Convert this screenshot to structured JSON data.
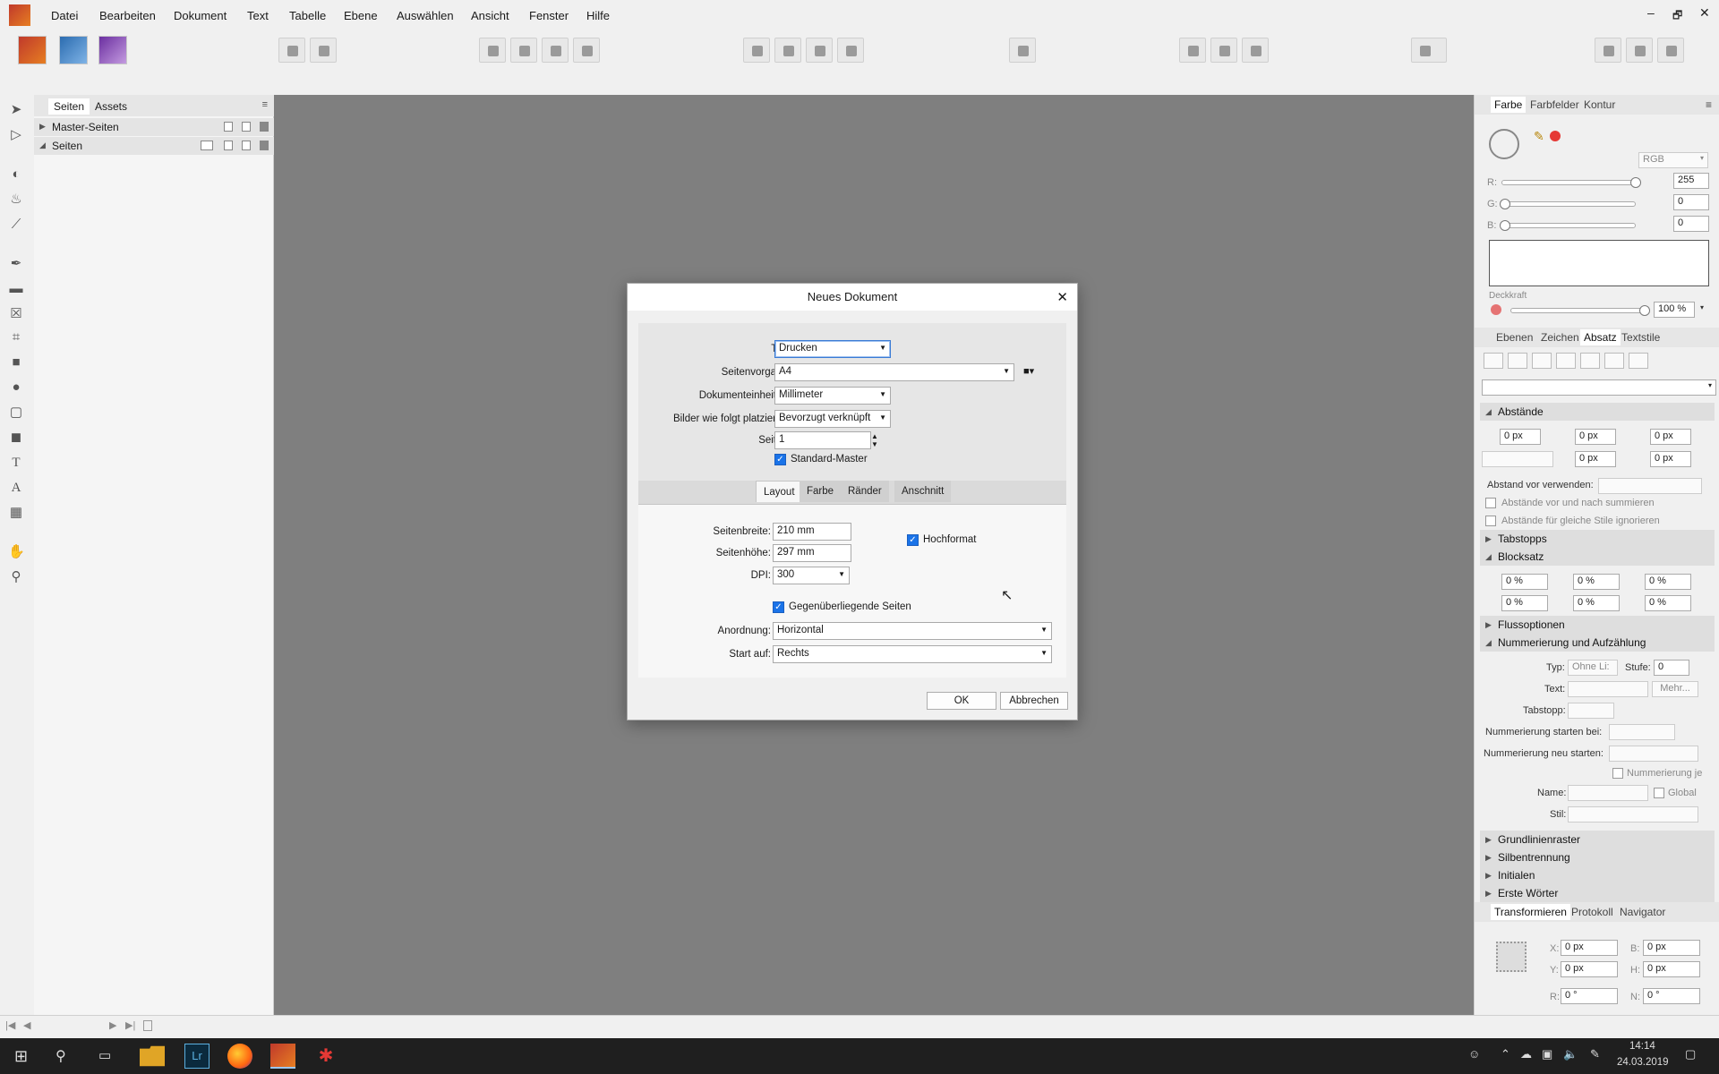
{
  "menubar": {
    "items": [
      "Datei",
      "Bearbeiten",
      "Dokument",
      "Text",
      "Tabelle",
      "Ebene",
      "Auswählen",
      "Ansicht",
      "Fenster",
      "Hilfe"
    ],
    "window_buttons": [
      "–",
      "🗗",
      "✕"
    ]
  },
  "left_panel": {
    "tabs": [
      "Seiten",
      "Assets"
    ],
    "rows": [
      "Master-Seiten",
      "Seiten"
    ]
  },
  "right_panel": {
    "color_tabs": [
      "Farbe",
      "Farbfelder",
      "Kontur"
    ],
    "color_model": "RGB",
    "r_label": "R:",
    "g_label": "G:",
    "b_label": "B:",
    "r": "255",
    "g": "0",
    "b": "0",
    "opacity_label": "Deckkraft",
    "opacity": "100 %",
    "para_tabs": [
      "Ebenen",
      "Zeichen",
      "Absatz",
      "Textstile"
    ],
    "sections": {
      "abstaende": "Abstände",
      "tabstopps": "Tabstopps",
      "blocksatz": "Blocksatz",
      "fluss": "Flussoptionen",
      "nummer": "Nummerierung und Aufzählung",
      "grund": "Grundlinienraster",
      "silben": "Silbentrennung",
      "initialen": "Initialen",
      "erste": "Erste Wörter"
    },
    "spacing_vals": [
      "0 px",
      "0 px",
      "0 px",
      "0 px",
      "0 px"
    ],
    "abstand_vor": "Abstand vor verwenden:",
    "cb1": "Abstände vor und nach summieren",
    "cb2": "Abstände für gleiche Stile ignorieren",
    "justify_vals": [
      "0 %",
      "0 %",
      "0 %",
      "0 %",
      "0 %",
      "0 %"
    ],
    "num": {
      "typ_label": "Typ:",
      "typ_val": "Ohne Li:",
      "stufe_label": "Stufe:",
      "stufe_val": "0",
      "text_label": "Text:",
      "mehr": "Mehr...",
      "tab_label": "Tabstopp:",
      "start_label": "Nummerierung starten bei:",
      "restart_label": "Nummerierung neu starten:",
      "je_label": "Nummerierung je",
      "name_label": "Name:",
      "global_label": "Global",
      "stil_label": "Stil:"
    },
    "transform_tabs": [
      "Transformieren",
      "Protokoll",
      "Navigator"
    ],
    "transform": {
      "x_label": "X:",
      "x": "0 px",
      "b_label": "B:",
      "b": "0 px",
      "y_label": "Y:",
      "y": "0 px",
      "h_label": "H:",
      "h": "0 px",
      "r_label": "R:",
      "r": "0 °",
      "n_label": "N:",
      "n": "0 °"
    }
  },
  "dialog": {
    "title": "Neues Dokument",
    "typ_label": "Typ:",
    "typ": "Drucken",
    "vorgabe_label": "Seitenvorgabe:",
    "vorgabe": "A4",
    "einheit_label": "Dokumenteinheiten:",
    "einheit": "Millimeter",
    "bilder_label": "Bilder wie folgt platzieren:",
    "bilder": "Bevorzugt verknüpft",
    "seiten_label": "Seiten:",
    "seiten": "1",
    "master_label": "Standard-Master",
    "tabs": [
      "Layout",
      "Farbe",
      "Ränder",
      "Anschnitt"
    ],
    "breite_label": "Seitenbreite:",
    "breite": "210 mm",
    "hoehe_label": "Seitenhöhe:",
    "hoehe": "297 mm",
    "dpi_label": "DPI:",
    "dpi": "300",
    "hoch_label": "Hochformat",
    "gegen_label": "Gegenüberliegende Seiten",
    "anord_label": "Anordnung:",
    "anord": "Horizontal",
    "start_label": "Start auf:",
    "start": "Rechts",
    "ok": "OK",
    "cancel": "Abbrechen"
  },
  "taskbar": {
    "time": "14:14",
    "date": "24.03.2019",
    "lr_label": "Lr"
  }
}
